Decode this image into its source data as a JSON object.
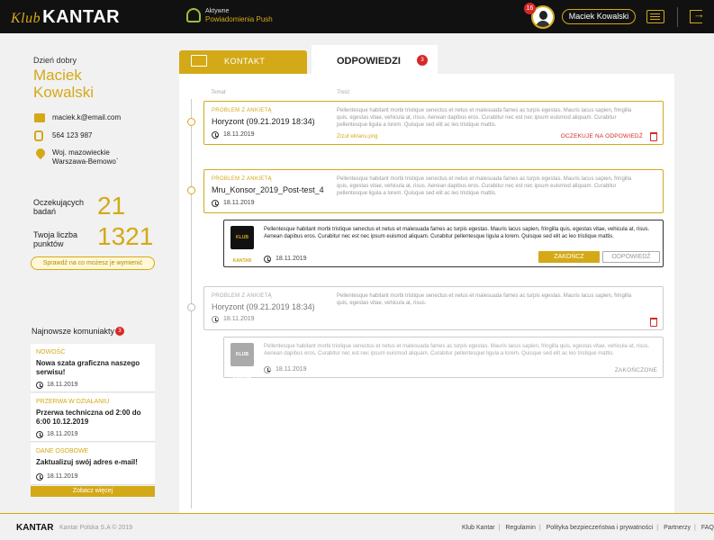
{
  "header": {
    "logo_prefix": "Klub",
    "logo_text": "KANTAR",
    "push_status": "Aktywne",
    "push_label": "Powiadomienia Push",
    "notifications_count": "16",
    "user_button": "Maciek Kowalski",
    "icons": [
      "bell-icon",
      "avatar",
      "message-icon",
      "logout-icon"
    ]
  },
  "sidebar": {
    "greeting": "Dzień dobry",
    "first_name": "Maciek",
    "last_name": "Kowalski",
    "email": "maciek.k@email.com",
    "phone": "564 123 987",
    "address_line1": "Woj. mazowieckie",
    "address_line2": "Warszawa-Bemowo`",
    "pending_label_1": "Oczekujących",
    "pending_label_2": "badań",
    "pending_value": "21",
    "points_label_1": "Twoja liczba",
    "points_label_2": "punktów",
    "points_value": "1321",
    "exchange_button": "Sprawdź na co możesz je wymienić",
    "news_heading": "Najnowsze komuniakty",
    "news_count": "3",
    "news": [
      {
        "category": "NOWOŚĆ",
        "title": "Nowa szata graficzna naszego serwisu!",
        "date": "18.11.2019"
      },
      {
        "category": "PRZERWA W DZIAŁANIU",
        "title": "Przerwa techniczna od 2:00 do 6:00 10.12.2019",
        "date": "18.11.2019"
      },
      {
        "category": "DANE OSOBOWE",
        "title": "Zaktualizuj swój adres e-mail!",
        "date": "18.11.2019"
      }
    ],
    "more_button": "Zobacz więcej"
  },
  "tabs": {
    "contact": "KONTAKT",
    "answers": "ODPOWIEDZI",
    "answers_count": "3"
  },
  "columns": {
    "topic": "Temat",
    "content": "Treść"
  },
  "body_text": "Pellentesque habitant morbi tristique senectus et netus et malesuada fames ac turpis egestas. Mauris lacus sapien, fringilla quis, egestas vitae, vehicula at, risus. Aenean dapibus eros. Curabitur nec est nec ipsum euismod aliquam. Curabitur pellentesque ligula a lorem. Quisque sed elit ac leo tristique mattis.",
  "body_text_short": "Pellentesque habitant morbi tristique senectus et netus et malesuada fames ac turpis egestas. Mauris lacus sapien, fringilla quis, egestas vitae, vehicula at, risus.",
  "reply_text": "Pellentesque habitant morbi tristique senectus et netus et malesuada fames ac turpis egestas. Mauris lacus sapien, fringilla quis, egestas vitae, vehicula at, risus. Aenean dapibus eros. Curabitur nec est nec ipsum euismod aliquam. Curabitur pellentesque ligula a lorem. Quisque sed elit ac leo tristique mattis.",
  "tickets": [
    {
      "category": "PROBLEM Z ANKIETĄ",
      "title": "Horyzont (09.21.2019 18:34)",
      "date": "18.11.2019",
      "attachment": "Zrzut ekranu.png",
      "status": "OCZEKUJE NA ODPOWIEDŹ"
    },
    {
      "category": "PROBLEM Z ANKIETĄ",
      "title": "Mru_Konsor_2019_Post-test_4",
      "date": "18.11.2019"
    },
    {
      "category": "PROBLEM Z ANKIETĄ",
      "title": "Horyzont (09.21.2019 18:34)",
      "date": "18.11.2019"
    }
  ],
  "replies": [
    {
      "thumb": "KLUB KANTAR",
      "date": "18.11.2019",
      "end_button": "ZAKOŃCZ",
      "reply_button": "ODPOWIEDŹ"
    },
    {
      "thumb": "KLUB KANTAR",
      "date": "18.11.2019",
      "status": "ZAKOŃCZONE"
    }
  ],
  "footer": {
    "logo": "KANTAR",
    "copyright": "Kantar Polska S.A © 2019",
    "links": [
      "Klub Kantar",
      "Regulamin",
      "Polityka bezpieczeństwa i prywatności",
      "Partnerzy",
      "FAQ"
    ]
  },
  "colors": {
    "accent": "#d4a917",
    "topbar": "#111111",
    "alert": "#d62828"
  }
}
